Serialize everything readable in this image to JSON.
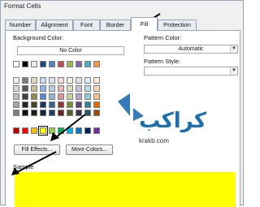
{
  "window": {
    "title": "Format Cells"
  },
  "tabs": [
    {
      "label": "Number"
    },
    {
      "label": "Alignment"
    },
    {
      "label": "Font"
    },
    {
      "label": "Border"
    },
    {
      "label": "Fill"
    },
    {
      "label": "Protection"
    }
  ],
  "fill": {
    "background_color_label": "Background Color:",
    "no_color_label": "No Color",
    "pattern_color_label": "Pattern Color:",
    "pattern_color_value": "Automatic",
    "pattern_style_label": "Pattern Style:",
    "fill_effects_label": "Fill Effects...",
    "more_colors_label": "More Colors...",
    "sample_label": "Sample",
    "sample_color": "#ffff00",
    "selected_color": "#ffff00",
    "palette_rows": [
      [
        "#ffffff",
        "#000000",
        "#eeece1",
        "#1f497d",
        "#4f81bd",
        "#c0504d",
        "#9bbb59",
        "#8064a2",
        "#4bacc6",
        "#f79646"
      ],
      [
        "#f2f2f2",
        "#7f7f7f",
        "#ddd9c3",
        "#c6d9f0",
        "#dbe5f1",
        "#f2dcdb",
        "#ebf1dd",
        "#e5e0ec",
        "#dbeef3",
        "#fdeada"
      ],
      [
        "#d8d8d8",
        "#595959",
        "#c4bd97",
        "#8db3e2",
        "#b8cce4",
        "#e5b9b7",
        "#d7e3bc",
        "#ccc1d9",
        "#b7dde8",
        "#fbd5b5"
      ],
      [
        "#bfbfbf",
        "#3f3f3f",
        "#938953",
        "#548dd4",
        "#95b3d7",
        "#d99694",
        "#c3d69b",
        "#b2a2c7",
        "#92cddc",
        "#fac08f"
      ],
      [
        "#a5a5a5",
        "#262626",
        "#494429",
        "#17365d",
        "#366092",
        "#953734",
        "#76923c",
        "#5f497a",
        "#31859b",
        "#e36c09"
      ],
      [
        "#7f7f7f",
        "#0c0c0c",
        "#1d1b10",
        "#0f243e",
        "#244061",
        "#632423",
        "#4f6128",
        "#3f3151",
        "#205867",
        "#974806"
      ]
    ],
    "standard_row": [
      "#c00000",
      "#ff0000",
      "#ffc000",
      "#ffff00",
      "#92d050",
      "#00b050",
      "#00b0f0",
      "#0070c0",
      "#002060",
      "#7030a0"
    ]
  },
  "watermark": {
    "logo_text": "کراکب",
    "site": "krakb.com",
    "accent": "#1e6fb0"
  }
}
